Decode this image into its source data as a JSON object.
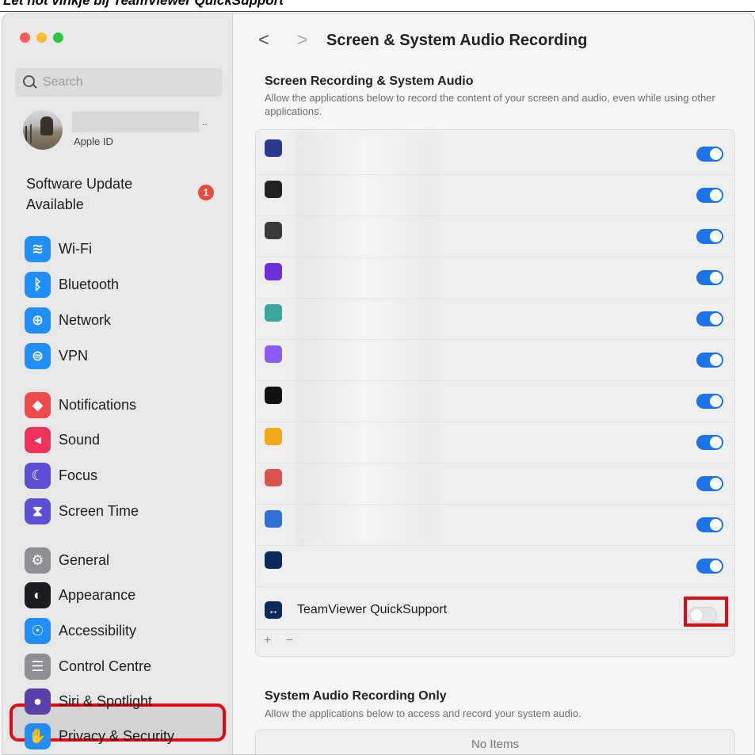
{
  "banner_text": "Let not vinkje bij TeamViewer QuickSupport",
  "colors": {
    "red": "#ff5f57",
    "yellow": "#febc2e",
    "green": "#28c840",
    "toggle_on": "#1a73e8",
    "highlight": "#e30613"
  },
  "sidebar": {
    "search_placeholder": "Search",
    "apple_id_label": "Apple ID",
    "apple_id_dots": "..",
    "update_label": "Software Update Available",
    "update_badge": "1",
    "groups": [
      [
        {
          "label": "Wi-Fi",
          "icon": "wifi-icon",
          "color": "#1f8fff",
          "glyph": "≋"
        },
        {
          "label": "Bluetooth",
          "icon": "bluetooth-icon",
          "color": "#1f8fff",
          "glyph": "ᛒ"
        },
        {
          "label": "Network",
          "icon": "globe-icon",
          "color": "#1f8fff",
          "glyph": "⊕"
        },
        {
          "label": "VPN",
          "icon": "vpn-icon",
          "color": "#1f8fff",
          "glyph": "⊜"
        }
      ],
      [
        {
          "label": "Notifications",
          "icon": "bell-icon",
          "color": "#f24a4a",
          "glyph": "◆"
        },
        {
          "label": "Sound",
          "icon": "speaker-icon",
          "color": "#f0325c",
          "glyph": "◂"
        },
        {
          "label": "Focus",
          "icon": "moon-icon",
          "color": "#5a4fd6",
          "glyph": "☾"
        },
        {
          "label": "Screen Time",
          "icon": "hourglass-icon",
          "color": "#5a4fd6",
          "glyph": "⧗"
        }
      ],
      [
        {
          "label": "General",
          "icon": "gear-icon",
          "color": "#8e8e93",
          "glyph": "⚙"
        },
        {
          "label": "Appearance",
          "icon": "appearance-icon",
          "color": "#1c1c1e",
          "glyph": "◐"
        },
        {
          "label": "Accessibility",
          "icon": "accessibility-icon",
          "color": "#1f8fff",
          "glyph": "☉"
        },
        {
          "label": "Control Centre",
          "icon": "control-centre-icon",
          "color": "#8e8e93",
          "glyph": "☰"
        },
        {
          "label": "Siri & Spotlight",
          "icon": "siri-icon",
          "color": "#5b3fa8",
          "glyph": "●"
        },
        {
          "label": "Privacy & Security",
          "icon": "hand-icon",
          "color": "#1f8fff",
          "glyph": "✋"
        }
      ]
    ]
  },
  "content": {
    "title": "Screen & System Audio Recording",
    "back_glyph": "<",
    "forward_glyph": ">",
    "section1_title": "Screen Recording & System Audio",
    "section1_desc": "Allow the applications below to record the content of your screen and audio, even while using other applications.",
    "apps": [
      {
        "icon": "app-icon-1",
        "color": "#2b3a8f",
        "on": true
      },
      {
        "icon": "app-icon-2",
        "color": "#222222",
        "on": true
      },
      {
        "icon": "app-icon-3",
        "color": "#3a3a3a",
        "on": true
      },
      {
        "icon": "app-icon-4",
        "color": "#6a2fd6",
        "on": true
      },
      {
        "icon": "app-icon-5",
        "color": "#3aa7a0",
        "on": true
      },
      {
        "icon": "app-icon-6",
        "color": "#8a5cf5",
        "on": true
      },
      {
        "icon": "app-icon-7",
        "color": "#111111",
        "on": true
      },
      {
        "icon": "app-icon-8",
        "color": "#f2a81d",
        "on": true
      },
      {
        "icon": "app-icon-9",
        "color": "#d9534f",
        "on": true
      },
      {
        "icon": "app-icon-10",
        "color": "#2f6fd6",
        "on": true
      },
      {
        "icon": "app-icon-11",
        "color": "#0a2a5e",
        "on": true
      }
    ],
    "teamviewer_label": "TeamViewer QuickSupport",
    "teamviewer_on": false,
    "plus": "+",
    "minus": "−",
    "section2_title": "System Audio Recording Only",
    "section2_desc": "Allow the applications below to access and record your system audio.",
    "no_items": "No Items"
  }
}
